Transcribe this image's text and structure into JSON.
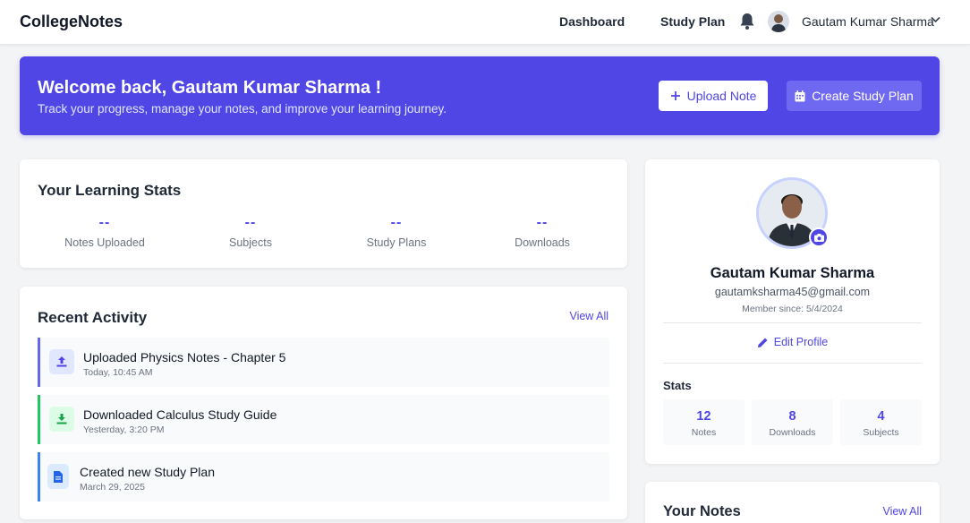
{
  "header": {
    "brand": "CollegeNotes",
    "nav": [
      "Dashboard",
      "Study Plan"
    ],
    "user_name": "Gautam Kumar Sharma"
  },
  "banner": {
    "title": "Welcome back, Gautam Kumar Sharma !",
    "subtitle": "Track your progress, manage your notes, and improve your learning journey.",
    "upload_label": "Upload Note",
    "plan_label": "Create Study Plan",
    "color": "#5046e5"
  },
  "learning_stats": {
    "title": "Your Learning Stats",
    "items": [
      {
        "value": "--",
        "label": "Notes Uploaded"
      },
      {
        "value": "--",
        "label": "Subjects"
      },
      {
        "value": "--",
        "label": "Study Plans"
      },
      {
        "value": "--",
        "label": "Downloads"
      }
    ]
  },
  "activity": {
    "title": "Recent Activity",
    "view_all": "View All",
    "items": [
      {
        "title": "Uploaded Physics Notes - Chapter 5",
        "time": "Today, 10:45 AM",
        "icon": "upload-icon",
        "accent": "#6366f1"
      },
      {
        "title": "Downloaded Calculus Study Guide",
        "time": "Yesterday, 3:20 PM",
        "icon": "download-icon",
        "accent": "#22c55e"
      },
      {
        "title": "Created new Study Plan",
        "time": "March 29, 2025",
        "icon": "document-icon",
        "accent": "#3b82f6"
      }
    ]
  },
  "profile": {
    "name": "Gautam Kumar Sharma",
    "email": "gautamksharma45@gmail.com",
    "member_since": "Member since: 5/4/2024",
    "edit_label": "Edit Profile",
    "stats_heading": "Stats",
    "stats": [
      {
        "value": "12",
        "label": "Notes"
      },
      {
        "value": "8",
        "label": "Downloads"
      },
      {
        "value": "4",
        "label": "Subjects"
      }
    ]
  },
  "notes": {
    "title": "Your Notes",
    "view_all": "View All"
  }
}
